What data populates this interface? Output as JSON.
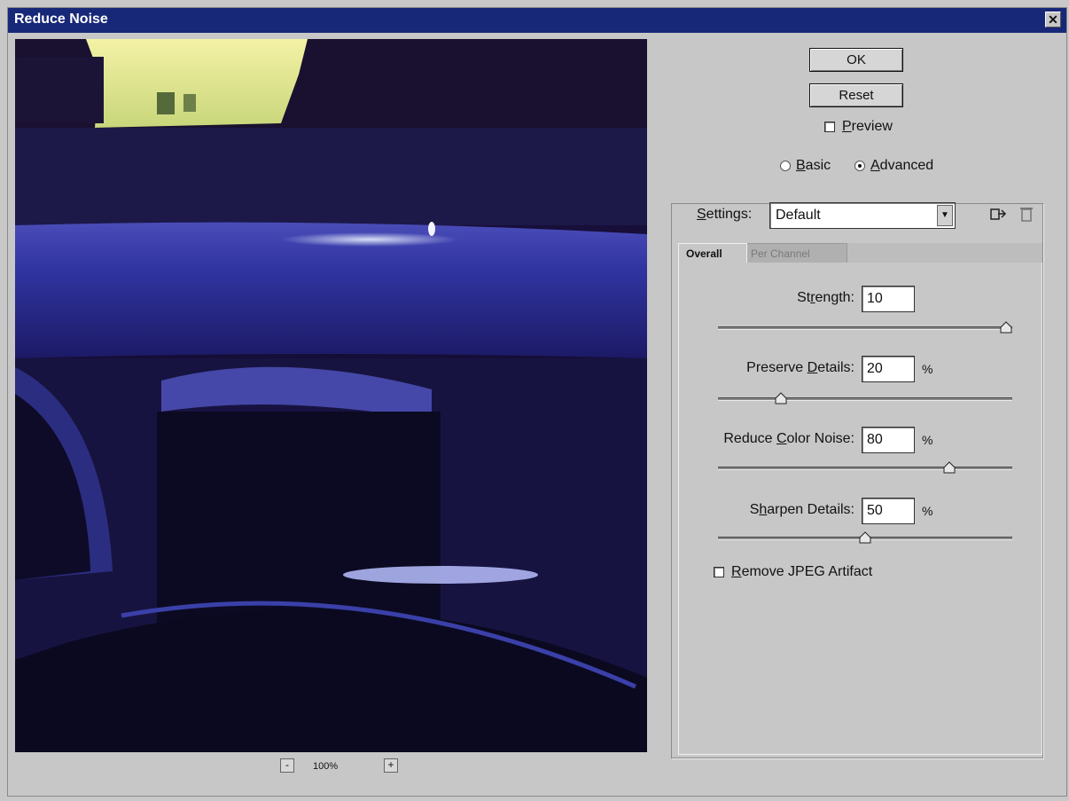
{
  "window": {
    "title": "Reduce Noise",
    "close_glyph": "✕"
  },
  "buttons": {
    "ok_label": "OK",
    "reset_label": "Reset"
  },
  "preview_toggle": {
    "label_underlined": "P",
    "label_rest": "review",
    "checked": false
  },
  "mode": {
    "basic": {
      "u": "B",
      "rest": "asic",
      "selected": false
    },
    "advanced": {
      "u": "A",
      "rest": "dvanced",
      "selected": true
    }
  },
  "settings": {
    "label_pre": "",
    "label_u": "S",
    "label_rest": "ettings:",
    "value": "Default",
    "icons": [
      "save-settings-icon",
      "delete-settings-icon"
    ]
  },
  "tabs": [
    {
      "label": "Overall",
      "active": true
    },
    {
      "label": "Per Channel",
      "active": false
    }
  ],
  "sliders": [
    {
      "label_pre": "St",
      "label_u": "r",
      "label_rest": "ength:",
      "value": "10",
      "unit": "",
      "level": 1.0
    },
    {
      "label_pre": "Preserve ",
      "label_u": "D",
      "label_rest": "etails:",
      "value": "20",
      "unit": "%",
      "level": 0.2
    },
    {
      "label_pre": "Reduce ",
      "label_u": "C",
      "label_rest": "olor Noise:",
      "value": "80",
      "unit": "%",
      "level": 0.8
    },
    {
      "label_pre": "S",
      "label_u": "h",
      "label_rest": "arpen Details:",
      "value": "50",
      "unit": "%",
      "level": 0.5
    }
  ],
  "jpeg_artifact": {
    "label_u": "R",
    "label_rest": "emove JPEG Artifact",
    "checked": false
  },
  "zoom": {
    "minus": "-",
    "plus": "+",
    "level": "100%"
  },
  "colors": {
    "title_bar": "#182878",
    "dialog_bg": "#c7c7c7",
    "preview_bg": "#140c36"
  }
}
